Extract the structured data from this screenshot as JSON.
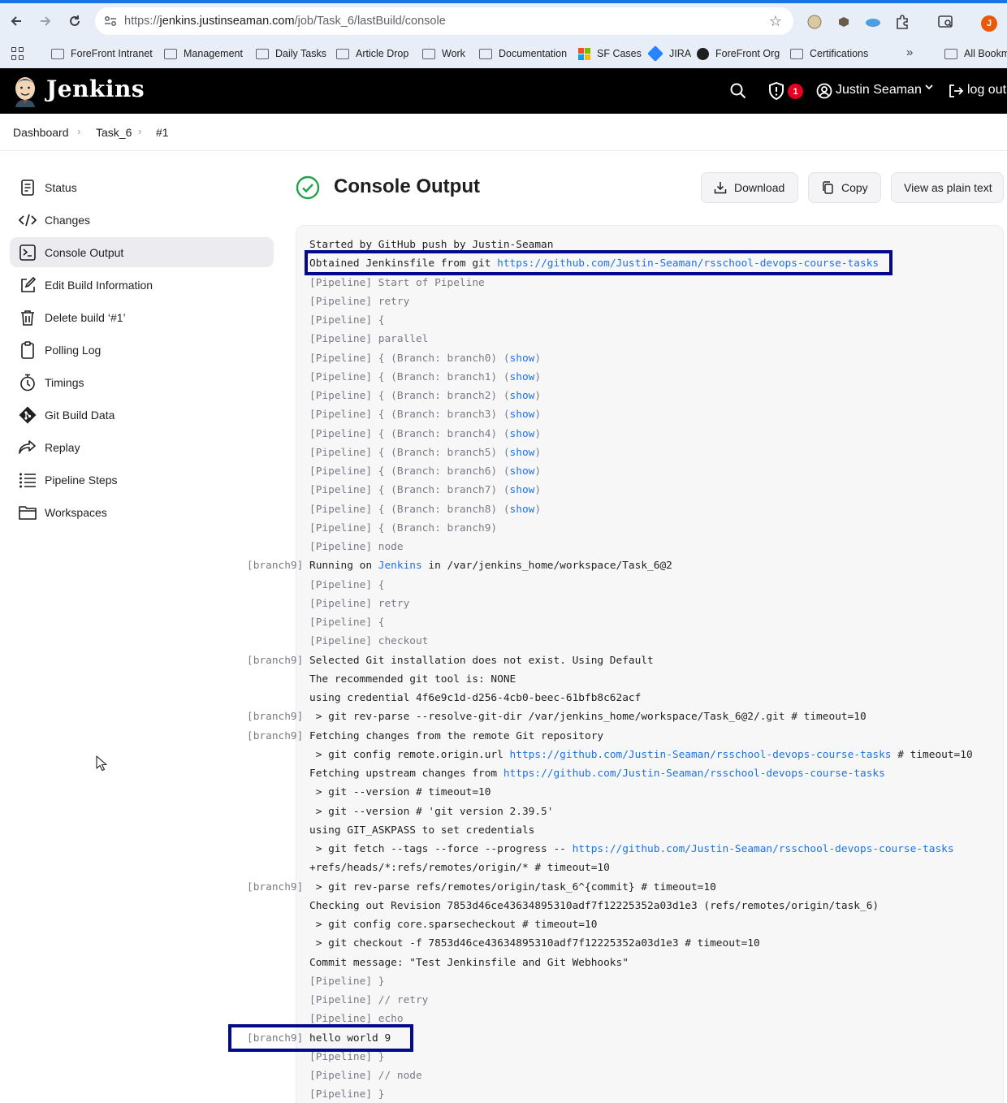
{
  "browser": {
    "url_prefix": "https://",
    "url_host": "jenkins.justinseaman.com",
    "url_path": "/job/Task_6/lastBuild/console",
    "profile_initial": "J",
    "bookmarks": [
      "ForeFront Intranet",
      "Management",
      "Daily Tasks",
      "Article Drop",
      "Work",
      "Documentation",
      "SF Cases",
      "JIRA",
      "ForeFront Org",
      "Certifications"
    ],
    "bookmarks_overflow": "All Bookm"
  },
  "header": {
    "app_name": "Jenkins",
    "security_count": "1",
    "user_name": "Justin Seaman",
    "logout_label": "log out"
  },
  "breadcrumb": [
    "Dashboard",
    "Task_6",
    "#1"
  ],
  "sidebar": {
    "items": [
      {
        "label": "Status",
        "icon": "document-icon"
      },
      {
        "label": "Changes",
        "icon": "code-icon"
      },
      {
        "label": "Console Output",
        "icon": "terminal-icon",
        "active": true
      },
      {
        "label": "Edit Build Information",
        "icon": "edit-icon"
      },
      {
        "label": "Delete build ‘#1’",
        "icon": "trash-icon"
      },
      {
        "label": "Polling Log",
        "icon": "clipboard-icon"
      },
      {
        "label": "Timings",
        "icon": "stopwatch-icon"
      },
      {
        "label": "Git Build Data",
        "icon": "git-icon"
      },
      {
        "label": "Replay",
        "icon": "replay-icon"
      },
      {
        "label": "Pipeline Steps",
        "icon": "list-icon"
      },
      {
        "label": "Workspaces",
        "icon": "folder-icon"
      }
    ]
  },
  "main": {
    "title": "Console Output",
    "buttons": {
      "download": "Download",
      "copy": "Copy",
      "plain_text": "View as plain text"
    }
  },
  "console": {
    "lines": [
      {
        "prefix": "",
        "parts": [
          [
            "t",
            "Started by GitHub push by Justin-Seaman"
          ]
        ]
      },
      {
        "prefix": "",
        "parts": [
          [
            "t",
            "Obtained Jenkinsfile from git "
          ],
          [
            "l",
            "https://github.com/Justin-Seaman/rsschool-devops-course-tasks"
          ]
        ]
      },
      {
        "prefix": "",
        "parts": [
          [
            "p",
            "[Pipeline] Start of Pipeline"
          ]
        ]
      },
      {
        "prefix": "",
        "parts": [
          [
            "p",
            "[Pipeline] retry"
          ]
        ]
      },
      {
        "prefix": "",
        "parts": [
          [
            "p",
            "[Pipeline] {"
          ]
        ]
      },
      {
        "prefix": "",
        "parts": [
          [
            "p",
            "[Pipeline] parallel"
          ]
        ]
      },
      {
        "prefix": "",
        "parts": [
          [
            "p",
            "[Pipeline] { (Branch: branch0) ("
          ],
          [
            "l",
            "show"
          ],
          [
            "p",
            ")"
          ]
        ]
      },
      {
        "prefix": "",
        "parts": [
          [
            "p",
            "[Pipeline] { (Branch: branch1) ("
          ],
          [
            "l",
            "show"
          ],
          [
            "p",
            ")"
          ]
        ]
      },
      {
        "prefix": "",
        "parts": [
          [
            "p",
            "[Pipeline] { (Branch: branch2) ("
          ],
          [
            "l",
            "show"
          ],
          [
            "p",
            ")"
          ]
        ]
      },
      {
        "prefix": "",
        "parts": [
          [
            "p",
            "[Pipeline] { (Branch: branch3) ("
          ],
          [
            "l",
            "show"
          ],
          [
            "p",
            ")"
          ]
        ]
      },
      {
        "prefix": "",
        "parts": [
          [
            "p",
            "[Pipeline] { (Branch: branch4) ("
          ],
          [
            "l",
            "show"
          ],
          [
            "p",
            ")"
          ]
        ]
      },
      {
        "prefix": "",
        "parts": [
          [
            "p",
            "[Pipeline] { (Branch: branch5) ("
          ],
          [
            "l",
            "show"
          ],
          [
            "p",
            ")"
          ]
        ]
      },
      {
        "prefix": "",
        "parts": [
          [
            "p",
            "[Pipeline] { (Branch: branch6) ("
          ],
          [
            "l",
            "show"
          ],
          [
            "p",
            ")"
          ]
        ]
      },
      {
        "prefix": "",
        "parts": [
          [
            "p",
            "[Pipeline] { (Branch: branch7) ("
          ],
          [
            "l",
            "show"
          ],
          [
            "p",
            ")"
          ]
        ]
      },
      {
        "prefix": "",
        "parts": [
          [
            "p",
            "[Pipeline] { (Branch: branch8) ("
          ],
          [
            "l",
            "show"
          ],
          [
            "p",
            ")"
          ]
        ]
      },
      {
        "prefix": "",
        "parts": [
          [
            "p",
            "[Pipeline] { (Branch: branch9)"
          ]
        ]
      },
      {
        "prefix": "",
        "parts": [
          [
            "p",
            "[Pipeline] node"
          ]
        ]
      },
      {
        "prefix": "[branch9]",
        "parts": [
          [
            "t",
            "Running on "
          ],
          [
            "l",
            "Jenkins"
          ],
          [
            "t",
            " in /var/jenkins_home/workspace/Task_6@2"
          ]
        ]
      },
      {
        "prefix": "",
        "parts": [
          [
            "p",
            "[Pipeline] {"
          ]
        ]
      },
      {
        "prefix": "",
        "parts": [
          [
            "p",
            "[Pipeline] retry"
          ]
        ]
      },
      {
        "prefix": "",
        "parts": [
          [
            "p",
            "[Pipeline] {"
          ]
        ]
      },
      {
        "prefix": "",
        "parts": [
          [
            "p",
            "[Pipeline] checkout"
          ]
        ]
      },
      {
        "prefix": "[branch9]",
        "parts": [
          [
            "t",
            "Selected Git installation does not exist. Using Default"
          ]
        ]
      },
      {
        "prefix": "",
        "parts": [
          [
            "t",
            "The recommended git tool is: NONE"
          ]
        ]
      },
      {
        "prefix": "",
        "parts": [
          [
            "t",
            "using credential 4f6e9c1d-d256-4cb0-beec-61bfb8c62acf"
          ]
        ]
      },
      {
        "prefix": "[branch9]",
        "parts": [
          [
            "t",
            " > git rev-parse --resolve-git-dir /var/jenkins_home/workspace/Task_6@2/.git # timeout=10"
          ]
        ]
      },
      {
        "prefix": "[branch9]",
        "parts": [
          [
            "t",
            "Fetching changes from the remote Git repository"
          ]
        ]
      },
      {
        "prefix": "",
        "parts": [
          [
            "t",
            " > git config remote.origin.url "
          ],
          [
            "l",
            "https://github.com/Justin-Seaman/rsschool-devops-course-tasks"
          ],
          [
            "t",
            " # timeout=10"
          ]
        ]
      },
      {
        "prefix": "",
        "parts": [
          [
            "t",
            "Fetching upstream changes from "
          ],
          [
            "l",
            "https://github.com/Justin-Seaman/rsschool-devops-course-tasks"
          ]
        ]
      },
      {
        "prefix": "",
        "parts": [
          [
            "t",
            " > git --version # timeout=10"
          ]
        ]
      },
      {
        "prefix": "",
        "parts": [
          [
            "t",
            " > git --version # 'git version 2.39.5'"
          ]
        ]
      },
      {
        "prefix": "",
        "parts": [
          [
            "t",
            "using GIT_ASKPASS to set credentials"
          ]
        ]
      },
      {
        "prefix": "",
        "parts": [
          [
            "t",
            " > git fetch --tags --force --progress -- "
          ],
          [
            "l",
            "https://github.com/Justin-Seaman/rsschool-devops-course-tasks"
          ]
        ]
      },
      {
        "prefix": "",
        "parts": [
          [
            "t",
            "+refs/heads/*:refs/remotes/origin/* # timeout=10"
          ]
        ]
      },
      {
        "prefix": "[branch9]",
        "parts": [
          [
            "t",
            " > git rev-parse refs/remotes/origin/task_6^{commit} # timeout=10"
          ]
        ]
      },
      {
        "prefix": "",
        "parts": [
          [
            "t",
            "Checking out Revision 7853d46ce43634895310adf7f12225352a03d1e3 (refs/remotes/origin/task_6)"
          ]
        ]
      },
      {
        "prefix": "",
        "parts": [
          [
            "t",
            " > git config core.sparsecheckout # timeout=10"
          ]
        ]
      },
      {
        "prefix": "",
        "parts": [
          [
            "t",
            " > git checkout -f 7853d46ce43634895310adf7f12225352a03d1e3 # timeout=10"
          ]
        ]
      },
      {
        "prefix": "",
        "parts": [
          [
            "t",
            "Commit message: \"Test Jenkinsfile and Git Webhooks\""
          ]
        ]
      },
      {
        "prefix": "",
        "parts": [
          [
            "p",
            "[Pipeline] }"
          ]
        ]
      },
      {
        "prefix": "",
        "parts": [
          [
            "p",
            "[Pipeline] // retry"
          ]
        ]
      },
      {
        "prefix": "",
        "parts": [
          [
            "p",
            "[Pipeline] echo"
          ]
        ]
      },
      {
        "prefix": "[branch9]",
        "parts": [
          [
            "t",
            "hello world 9"
          ]
        ]
      },
      {
        "prefix": "",
        "parts": [
          [
            "p",
            "[Pipeline] }"
          ]
        ]
      },
      {
        "prefix": "",
        "parts": [
          [
            "p",
            "[Pipeline] // node"
          ]
        ]
      },
      {
        "prefix": "",
        "parts": [
          [
            "p",
            "[Pipeline] }"
          ]
        ]
      }
    ]
  },
  "colors": {
    "header_bg": "#000000",
    "link": "#1a73e8",
    "success": "#1ea446",
    "highlight_box": "#000a8a",
    "badge": "#e6001f"
  }
}
